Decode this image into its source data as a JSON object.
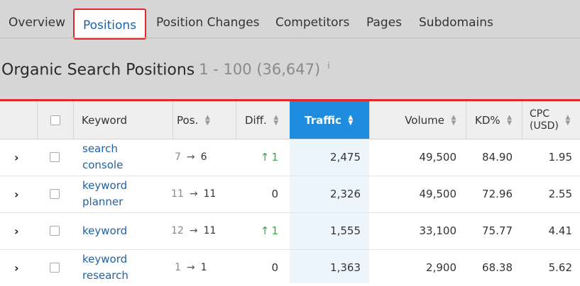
{
  "tabs": [
    "Overview",
    "Positions",
    "Position Changes",
    "Competitors",
    "Pages",
    "Subdomains"
  ],
  "title": {
    "text": "Organic Search Positions",
    "range": "1 - 100 (36,647)",
    "info": "i"
  },
  "columns": {
    "keyword": "Keyword",
    "pos": "Pos.",
    "diff": "Diff.",
    "traffic": "Traffic",
    "volume": "Volume",
    "kd": "KD%",
    "cpc_line1": "CPC",
    "cpc_line2": "(USD)"
  },
  "rows": [
    {
      "kw1": "search",
      "kw2": "console",
      "prev": "7",
      "cur": "6",
      "diff_arrow": "↑",
      "diff": "1",
      "traffic": "2,475",
      "volume": "49,500",
      "kd": "84.90",
      "cpc": "1.95"
    },
    {
      "kw1": "keyword",
      "kw2": "planner",
      "prev": "11",
      "cur": "11",
      "diff_arrow": "",
      "diff": "0",
      "traffic": "2,326",
      "volume": "49,500",
      "kd": "72.96",
      "cpc": "2.55"
    },
    {
      "kw1": "keyword",
      "kw2": "",
      "prev": "12",
      "cur": "11",
      "diff_arrow": "↑",
      "diff": "1",
      "traffic": "1,555",
      "volume": "33,100",
      "kd": "75.77",
      "cpc": "4.41"
    },
    {
      "kw1": "keyword",
      "kw2": "research",
      "prev": "1",
      "cur": "1",
      "diff_arrow": "",
      "diff": "0",
      "traffic": "1,363",
      "volume": "2,900",
      "kd": "68.38",
      "cpc": "5.62"
    }
  ],
  "colors": {
    "active_tab_border": "#e02a2a",
    "link": "#1f62a3",
    "traffic_header": "#1e8de0",
    "up": "#3aa64c"
  },
  "icons": {
    "expand": "chevron-right-icon",
    "sort": "sort-icon",
    "info": "info-icon"
  }
}
